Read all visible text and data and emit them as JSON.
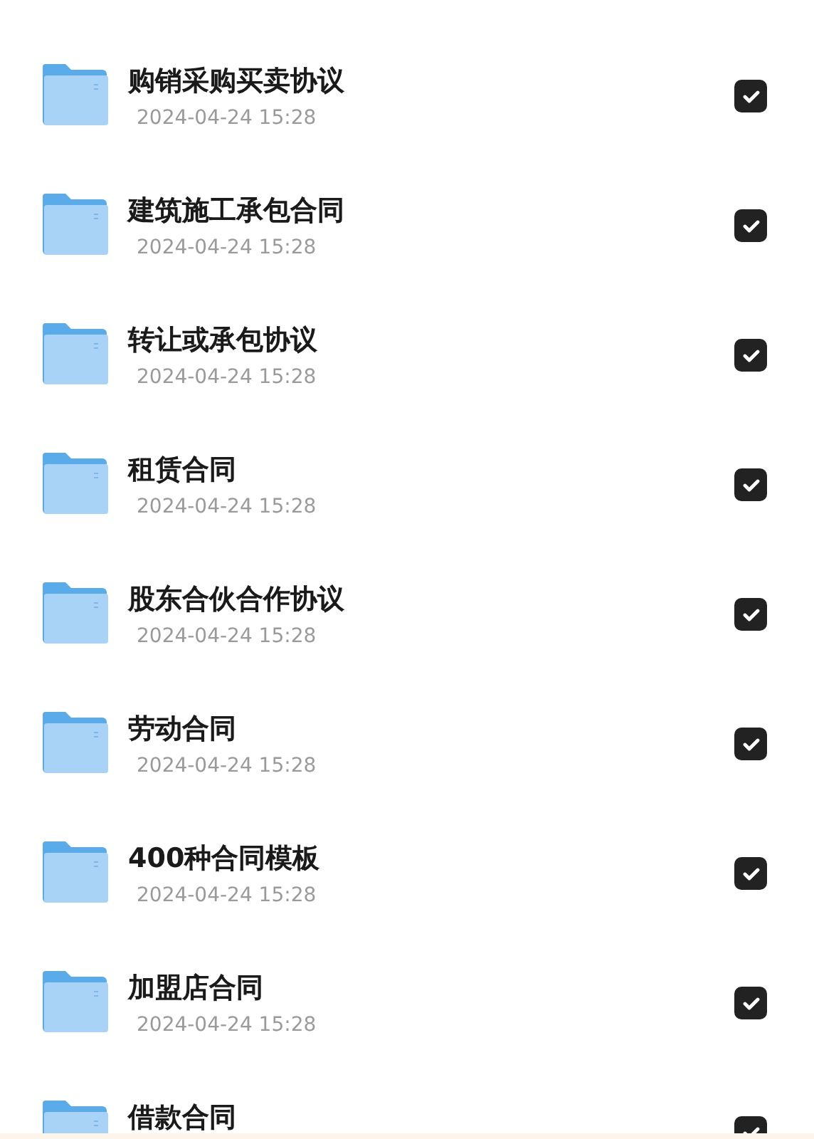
{
  "files": [
    {
      "name": "购销采购买卖协议",
      "date": "2024-04-24 15:28",
      "checked": true
    },
    {
      "name": "建筑施工承包合同",
      "date": "2024-04-24 15:28",
      "checked": true
    },
    {
      "name": "转让或承包协议",
      "date": "2024-04-24 15:28",
      "checked": true
    },
    {
      "name": "租赁合同",
      "date": "2024-04-24 15:28",
      "checked": true
    },
    {
      "name": "股东合伙合作协议",
      "date": "2024-04-24 15:28",
      "checked": true
    },
    {
      "name": "劳动合同",
      "date": "2024-04-24 15:28",
      "checked": true
    },
    {
      "name": "400种合同模板",
      "date": "2024-04-24 15:28",
      "checked": true
    },
    {
      "name": "加盟店合同",
      "date": "2024-04-24 15:28",
      "checked": true
    },
    {
      "name": "借款合同",
      "checked": true
    }
  ]
}
